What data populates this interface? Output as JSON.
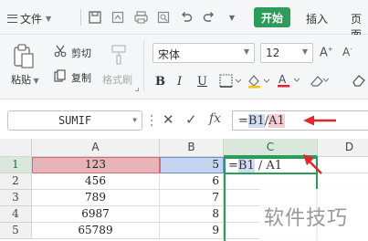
{
  "menu": {
    "file_label": "文件"
  },
  "tabs": {
    "start_label": "开始",
    "insert_label": "插入",
    "page_label": "页面"
  },
  "ribbon": {
    "paste_label": "粘贴",
    "cut_label": "剪切",
    "copy_label": "复制",
    "format_painter_label": "格式刷",
    "font_name": "宋体",
    "font_size": "12",
    "bold_label": "B",
    "italic_label": "I",
    "underline_label": "U"
  },
  "formula_bar": {
    "name_box": "SUMIF",
    "fx_label": "fx",
    "formula_prefix": "=",
    "ref1": "B1",
    "op": "/",
    "ref2": "A1"
  },
  "sheet": {
    "columns": [
      "A",
      "B",
      "C",
      "D"
    ],
    "rows": [
      {
        "num": "1",
        "a": "123",
        "b": "5"
      },
      {
        "num": "2",
        "a": "456",
        "b": "6"
      },
      {
        "num": "3",
        "a": "789",
        "b": "7"
      },
      {
        "num": "4",
        "a": "6987",
        "b": "8"
      },
      {
        "num": "5",
        "a": "65789",
        "b": "9"
      }
    ],
    "active_cell_edit": {
      "prefix": "=",
      "ref1": "B1",
      "op": " / ",
      "ref2": "A1"
    }
  },
  "watermark": "软件技巧",
  "colors": {
    "accent": "#2d9b5a",
    "arrow": "#e0262b",
    "ref_a": "#e7b4b7",
    "ref_b": "#c5d4ef"
  }
}
